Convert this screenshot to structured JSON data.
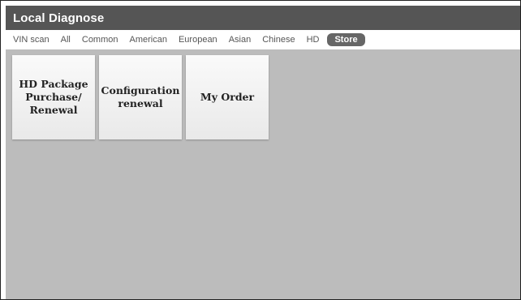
{
  "header": {
    "title": "Local Diagnose"
  },
  "tabs": [
    {
      "label": "VIN scan"
    },
    {
      "label": "All"
    },
    {
      "label": "Common"
    },
    {
      "label": "American"
    },
    {
      "label": "European"
    },
    {
      "label": "Asian"
    },
    {
      "label": "Chinese"
    },
    {
      "label": "HD"
    },
    {
      "label": "Store",
      "active": true
    }
  ],
  "tiles": [
    {
      "label": "HD Package\nPurchase/\nRenewal"
    },
    {
      "label": "Configuration\nrenewal"
    },
    {
      "label": "My Order"
    }
  ],
  "colors": {
    "titlebar": "#555555",
    "active_tab": "#666666",
    "content_bg": "#bcbcbc",
    "tile_bg": "#f2f2f2"
  }
}
